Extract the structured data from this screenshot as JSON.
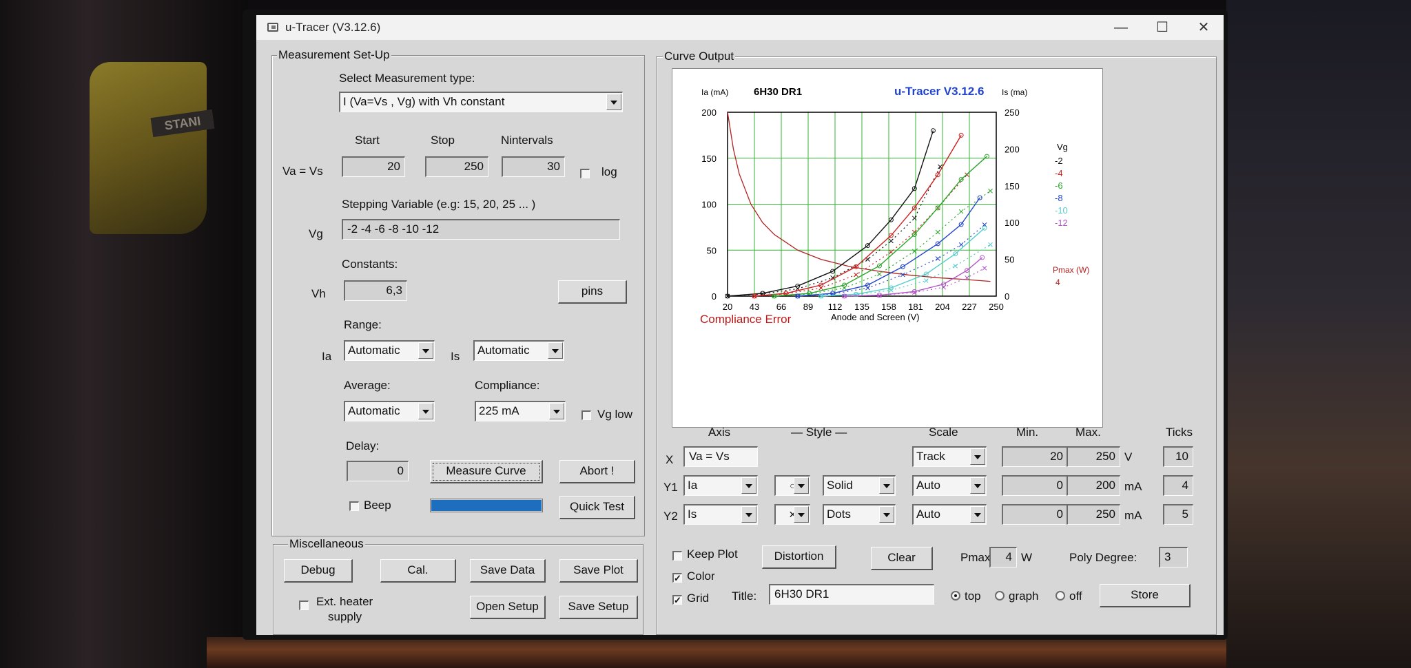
{
  "window": {
    "title": "u-Tracer (V3.12.6)",
    "minimize": "—",
    "maximize": "☐",
    "close": "✕",
    "background_label": "STANI"
  },
  "setup": {
    "group": "Measurement Set-Up",
    "select_type_label": "Select Measurement type:",
    "measurement_type": "I (Va=Vs , Vg) with Vh constant",
    "start_header": "Start",
    "stop_header": "Stop",
    "nintervals_header": "Nintervals",
    "va_label": "Va = Vs",
    "start": "20",
    "stop": "250",
    "nintervals": "30",
    "log_label": "log",
    "stepping_label": "Stepping Variable (e.g: 15, 20, 25 ... )",
    "vg_label": "Vg",
    "vg_values": "-2 -4 -6 -8 -10 -12",
    "constants_label": "Constants:",
    "vh_label": "Vh",
    "vh_value": "6,3",
    "pins_button": "pins",
    "range_label": "Range:",
    "ia_label": "Ia",
    "ia_range": "Automatic",
    "is_label": "Is",
    "is_range": "Automatic",
    "average_label": "Average:",
    "average_value": "Automatic",
    "compliance_label": "Compliance:",
    "compliance_value": "225 mA",
    "vg_low_label": "Vg low",
    "delay_label": "Delay:",
    "delay_value": "0",
    "measure_button": "Measure Curve",
    "abort_button": "Abort !",
    "beep_label": "Beep",
    "progress": 1.0,
    "quick_test_button": "Quick Test"
  },
  "misc": {
    "group": "Miscellaneous",
    "debug": "Debug",
    "cal": "Cal.",
    "save_data": "Save Data",
    "save_plot": "Save Plot",
    "ext_heater_1": "Ext. heater",
    "ext_heater_2": "supply",
    "open_setup": "Open Setup",
    "save_setup": "Save Setup"
  },
  "curve": {
    "group": "Curve Output",
    "axis_header": "Axis",
    "style_header": "— Style —",
    "scale_header": "Scale",
    "min_header": "Min.",
    "max_header": "Max.",
    "ticks_header": "Ticks",
    "x": {
      "label": "X",
      "axis": "Va = Vs",
      "scale": "Track",
      "min": "20",
      "max": "250",
      "unit": "V",
      "ticks": "10"
    },
    "y1": {
      "label": "Y1",
      "axis": "Ia",
      "marker": "○",
      "style": "Solid",
      "scale": "Auto",
      "min": "0",
      "max": "200",
      "unit": "mA",
      "ticks": "4"
    },
    "y2": {
      "label": "Y2",
      "axis": "Is",
      "marker": "✕",
      "style": "Dots",
      "scale": "Auto",
      "min": "0",
      "max": "250",
      "unit": "mA",
      "ticks": "5"
    },
    "keep_plot": "Keep Plot",
    "distortion": "Distortion",
    "clear": "Clear",
    "pmax_label": "Pmax",
    "pmax_value": "4",
    "pmax_unit": "W",
    "poly_label": "Poly Degree:",
    "poly_value": "3",
    "color_label": "Color",
    "grid_label": "Grid",
    "title_label": "Title:",
    "title_value": "6H30 DR1",
    "radio_top": "top",
    "radio_graph": "graph",
    "radio_off": "off",
    "store": "Store"
  },
  "chart_data": {
    "type": "line",
    "title": "6H30 DR1",
    "brand": "u-Tracer V3.12.6",
    "ylabel": "Ia (mA)",
    "y2label": "Is (ma)",
    "xlabel": "Anode and Screen (V)",
    "x_ticks": [
      20,
      43,
      66,
      89,
      112,
      135,
      158,
      181,
      204,
      227,
      250
    ],
    "y_ticks": [
      0,
      50,
      100,
      150,
      200
    ],
    "y2_ticks": [
      0,
      50,
      100,
      150,
      200,
      250
    ],
    "xlim": [
      20,
      250
    ],
    "ylim": [
      0,
      200
    ],
    "y2lim": [
      0,
      250
    ],
    "grid": true,
    "legend_title": "Vg",
    "pmax_label": "Pmax (W)",
    "pmax_value": "4",
    "compliance_text": "Compliance Error",
    "colors": {
      "pmax": "#b22222",
      "compliance": "#c01818",
      "brand": "#2244cc"
    },
    "series": [
      {
        "name": "-2",
        "color": "#111111",
        "ia": [
          [
            20,
            0
          ],
          [
            50,
            3
          ],
          [
            80,
            11
          ],
          [
            110,
            27
          ],
          [
            140,
            55
          ],
          [
            160,
            83
          ],
          [
            180,
            117
          ],
          [
            196,
            180
          ]
        ],
        "is": [
          [
            20,
            0
          ],
          [
            50,
            3
          ],
          [
            80,
            10
          ],
          [
            110,
            25
          ],
          [
            140,
            50
          ],
          [
            160,
            75
          ],
          [
            180,
            106
          ],
          [
            202,
            176
          ]
        ]
      },
      {
        "name": "-4",
        "color": "#cc2020",
        "ia": [
          [
            43,
            0
          ],
          [
            70,
            3
          ],
          [
            100,
            12
          ],
          [
            130,
            32
          ],
          [
            160,
            66
          ],
          [
            180,
            96
          ],
          [
            200,
            132
          ],
          [
            220,
            175
          ]
        ],
        "is": [
          [
            43,
            0
          ],
          [
            70,
            3
          ],
          [
            100,
            11
          ],
          [
            130,
            29
          ],
          [
            160,
            60
          ],
          [
            180,
            87
          ],
          [
            200,
            120
          ],
          [
            225,
            165
          ]
        ]
      },
      {
        "name": "-6",
        "color": "#2aa52a",
        "ia": [
          [
            60,
            0
          ],
          [
            90,
            3
          ],
          [
            120,
            12
          ],
          [
            150,
            33
          ],
          [
            180,
            67
          ],
          [
            200,
            96
          ],
          [
            220,
            127
          ],
          [
            242,
            152
          ]
        ],
        "is": [
          [
            60,
            0
          ],
          [
            90,
            3
          ],
          [
            120,
            11
          ],
          [
            150,
            30
          ],
          [
            180,
            61
          ],
          [
            200,
            87
          ],
          [
            220,
            115
          ],
          [
            245,
            143
          ]
        ]
      },
      {
        "name": "-8",
        "color": "#2244cc",
        "ia": [
          [
            80,
            0
          ],
          [
            110,
            3
          ],
          [
            140,
            12
          ],
          [
            170,
            32
          ],
          [
            200,
            57
          ],
          [
            220,
            78
          ],
          [
            236,
            107
          ]
        ],
        "is": [
          [
            80,
            0
          ],
          [
            110,
            3
          ],
          [
            140,
            11
          ],
          [
            170,
            29
          ],
          [
            200,
            51
          ],
          [
            220,
            70
          ],
          [
            240,
            97
          ]
        ]
      },
      {
        "name": "-10",
        "color": "#55cccc",
        "ia": [
          [
            100,
            0
          ],
          [
            130,
            2
          ],
          [
            160,
            9
          ],
          [
            190,
            24
          ],
          [
            215,
            46
          ],
          [
            240,
            74
          ]
        ],
        "is": [
          [
            100,
            0
          ],
          [
            130,
            2
          ],
          [
            160,
            8
          ],
          [
            190,
            21
          ],
          [
            215,
            41
          ],
          [
            245,
            70
          ]
        ]
      },
      {
        "name": "-12",
        "color": "#b455c8",
        "ia": [
          [
            120,
            0
          ],
          [
            150,
            1
          ],
          [
            180,
            5
          ],
          [
            205,
            13
          ],
          [
            225,
            28
          ],
          [
            238,
            42
          ]
        ],
        "is": [
          [
            120,
            0
          ],
          [
            150,
            1
          ],
          [
            180,
            5
          ],
          [
            205,
            12
          ],
          [
            225,
            25
          ],
          [
            240,
            38
          ]
        ]
      }
    ],
    "pmax_curve": [
      [
        20,
        200
      ],
      [
        25,
        160
      ],
      [
        30,
        133
      ],
      [
        40,
        100
      ],
      [
        50,
        80
      ],
      [
        60,
        67
      ],
      [
        80,
        50
      ],
      [
        100,
        40
      ],
      [
        125,
        32
      ],
      [
        150,
        27
      ],
      [
        175,
        23
      ],
      [
        200,
        20
      ],
      [
        225,
        18
      ],
      [
        245,
        16
      ]
    ]
  }
}
